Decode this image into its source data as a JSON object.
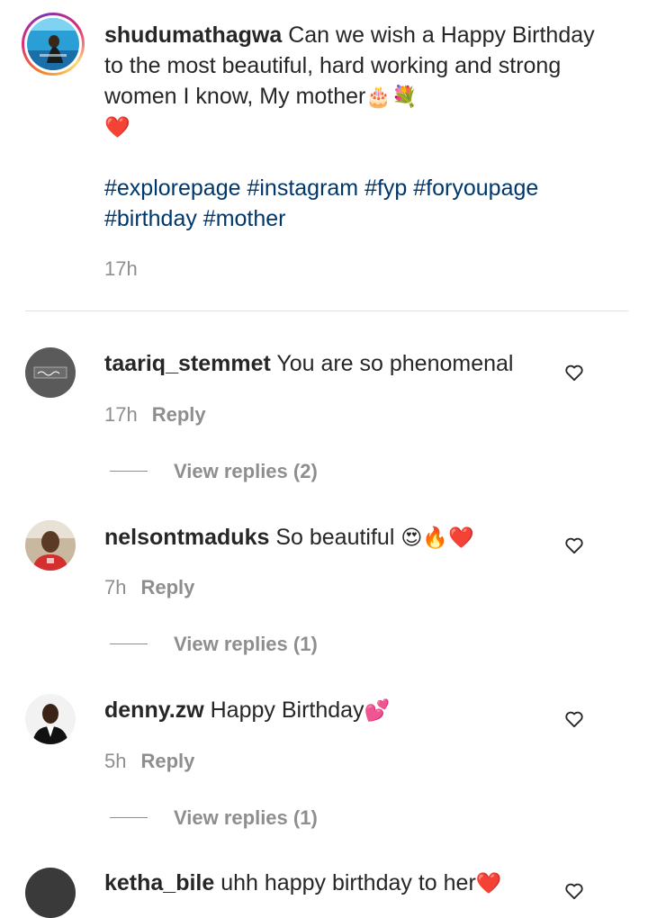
{
  "post": {
    "username": "shudumathagwa",
    "caption": "Can we wish a Happy Birthday to the most beautiful, hard working and strong women I know, My mother",
    "caption_emojis": "🎂💐",
    "caption_heart": "❤️",
    "hashtags_line1": "#explorepage #instagram #fyp #foryoupage",
    "hashtags_line2": "#birthday #mother",
    "time": "17h"
  },
  "comments": [
    {
      "username": "taariq_stemmet",
      "text": "You are so phenomenal",
      "emojis": "",
      "time": "17h",
      "reply_label": "Reply",
      "view_replies": "View replies (2)"
    },
    {
      "username": "nelsontmaduks",
      "text": "So beautiful",
      "emojis": "😍🔥❤️",
      "time": "7h",
      "reply_label": "Reply",
      "view_replies": "View replies (1)"
    },
    {
      "username": "denny.zw",
      "text": "Happy Birthday",
      "emojis": "💕",
      "time": "5h",
      "reply_label": "Reply",
      "view_replies": "View replies (1)"
    },
    {
      "username": "ketha_bile",
      "text": "uhh happy birthday to her",
      "emojis": "❤️"
    }
  ],
  "colors": {
    "text": "#262626",
    "secondary": "#8e8e8e",
    "hashtag": "#00376b",
    "divider": "#e0e0e0"
  },
  "icons": [
    "heart-outline-icon"
  ]
}
